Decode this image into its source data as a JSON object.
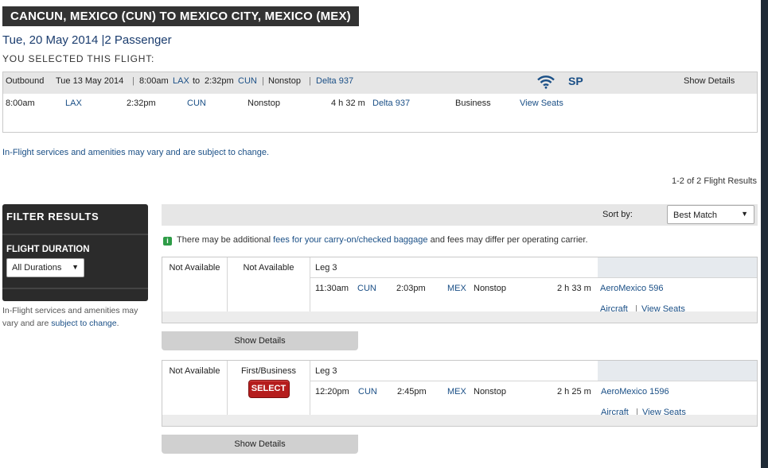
{
  "header": {
    "route": "CANCUN, MEXICO (CUN) TO MEXICO CITY, MEXICO (MEX)",
    "date_line": "Tue, 20 May 2014 |2 Passenger",
    "selected_heading": "YOU SELECTED THIS FLIGHT:"
  },
  "selected_flight": {
    "summary": {
      "label": "Outbound",
      "date": "Tue 13 May 2014",
      "sep1": "|",
      "depart_time": "8:00am",
      "depart_airport": "LAX",
      "to": "to",
      "arrive_time": "2:32pm",
      "arrive_airport": "CUN",
      "sep2": "|",
      "stops": "Nonstop",
      "sep3": "|",
      "flight": "Delta 937",
      "sp": "SP",
      "show_details": "Show Details"
    },
    "detail": {
      "depart_time": "8:00am",
      "depart_airport": "LAX",
      "arrive_time": "2:32pm",
      "arrive_airport": "CUN",
      "stops": "Nonstop",
      "duration": "4 h 32 m",
      "flight": "Delta 937",
      "cabin": "Business",
      "view_seats": "View Seats"
    },
    "wifi_icon": "wifi-icon"
  },
  "disclaimer": "In-Flight services and amenities may vary and are subject to change.",
  "results_count": "1-2 of 2 Flight Results",
  "filter": {
    "title": "FILTER RESULTS",
    "duration_label": "FLIGHT DURATION",
    "duration_value": "All Durations",
    "note_text": "In-Flight services and amenities may vary and are",
    "note_link": "subject to change",
    "note_end": "."
  },
  "sort": {
    "label": "Sort by:",
    "value": "Best Match"
  },
  "baggage_notice": {
    "icon": "info-icon",
    "text_before": "There may be additional",
    "link": "fees for your carry-on/checked baggage",
    "text_after": "and fees may differ per operating carrier."
  },
  "results": [
    {
      "basic": "Not Available",
      "first": "Not Available",
      "leg": "Leg 3",
      "depart_time": "11:30am",
      "depart_airport": "CUN",
      "arrive_time": "2:03pm",
      "arrive_airport": "MEX",
      "stops": "Nonstop",
      "duration": "2 h 33 m",
      "flight": "AeroMexico 596",
      "aircraft": "Aircraft",
      "sep": "|",
      "view_seats": "View Seats",
      "show_details": "Show Details"
    },
    {
      "basic": "Not Available",
      "first": "First/Business",
      "select_label": "SELECT",
      "leg": "Leg 3",
      "depart_time": "12:20pm",
      "depart_airport": "CUN",
      "arrive_time": "2:45pm",
      "arrive_airport": "MEX",
      "stops": "Nonstop",
      "duration": "2 h 25 m",
      "flight": "AeroMexico 1596",
      "aircraft": "Aircraft",
      "sep": "|",
      "view_seats": "View Seats",
      "show_details": "Show Details"
    }
  ],
  "colors": {
    "title_bar": "#333333",
    "link": "#1a4f86",
    "select_button": "#b51d1d",
    "notice_icon": "#2e9c47"
  }
}
